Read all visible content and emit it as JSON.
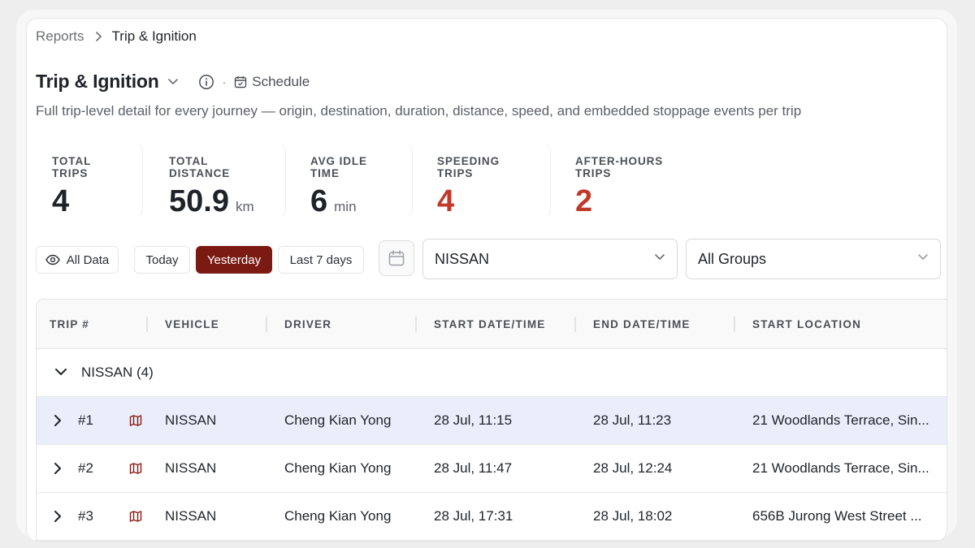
{
  "breadcrumb": {
    "parent": "Reports",
    "current": "Trip & Ignition"
  },
  "header": {
    "title": "Trip & Ignition",
    "separator": "·",
    "schedule_label": "Schedule",
    "subtitle": "Full trip-level detail for every journey — origin, destination, duration, distance, speed, and embedded stoppage events per trip"
  },
  "kpis": [
    {
      "label": "TOTAL TRIPS",
      "value": "4",
      "unit": ""
    },
    {
      "label": "TOTAL DISTANCE",
      "value": "50.9",
      "unit": "km"
    },
    {
      "label": "AVG IDLE TIME",
      "value": "6",
      "unit": "min"
    },
    {
      "label": "SPEEDING TRIPS",
      "value": "4",
      "unit": ""
    },
    {
      "label": "AFTER-HOURS TRIPS",
      "value": "2",
      "unit": ""
    }
  ],
  "filters": {
    "all_data": "All Data",
    "today": "Today",
    "yesterday": "Yesterday",
    "last7": "Last 7 days",
    "active_range": "Yesterday",
    "vehicle_select": "NISSAN",
    "group_select": "All Groups"
  },
  "table": {
    "columns": [
      "TRIP #",
      "VEHICLE",
      "DRIVER",
      "START DATE/TIME",
      "END DATE/TIME",
      "START LOCATION"
    ],
    "group_label": "NISSAN (4)",
    "rows": [
      {
        "trip": "#1",
        "vehicle": "NISSAN",
        "driver": "Cheng Kian Yong",
        "start": "28 Jul, 11:15",
        "end": "28 Jul, 11:23",
        "location": "21 Woodlands Terrace, Sin..."
      },
      {
        "trip": "#2",
        "vehicle": "NISSAN",
        "driver": "Cheng Kian Yong",
        "start": "28 Jul, 11:47",
        "end": "28 Jul, 12:24",
        "location": "21 Woodlands Terrace, Sin..."
      },
      {
        "trip": "#3",
        "vehicle": "NISSAN",
        "driver": "Cheng Kian Yong",
        "start": "28 Jul, 17:31",
        "end": "28 Jul, 18:02",
        "location": "656B Jurong West Street ..."
      }
    ]
  },
  "colors": {
    "accent": "#7a1a12",
    "alert_red": "#c0392b",
    "selected_row": "#e9eefa"
  },
  "icons": [
    "chevron-right-icon",
    "chevron-down-icon",
    "info-icon",
    "calendar-icon",
    "eye-icon",
    "map-icon"
  ]
}
